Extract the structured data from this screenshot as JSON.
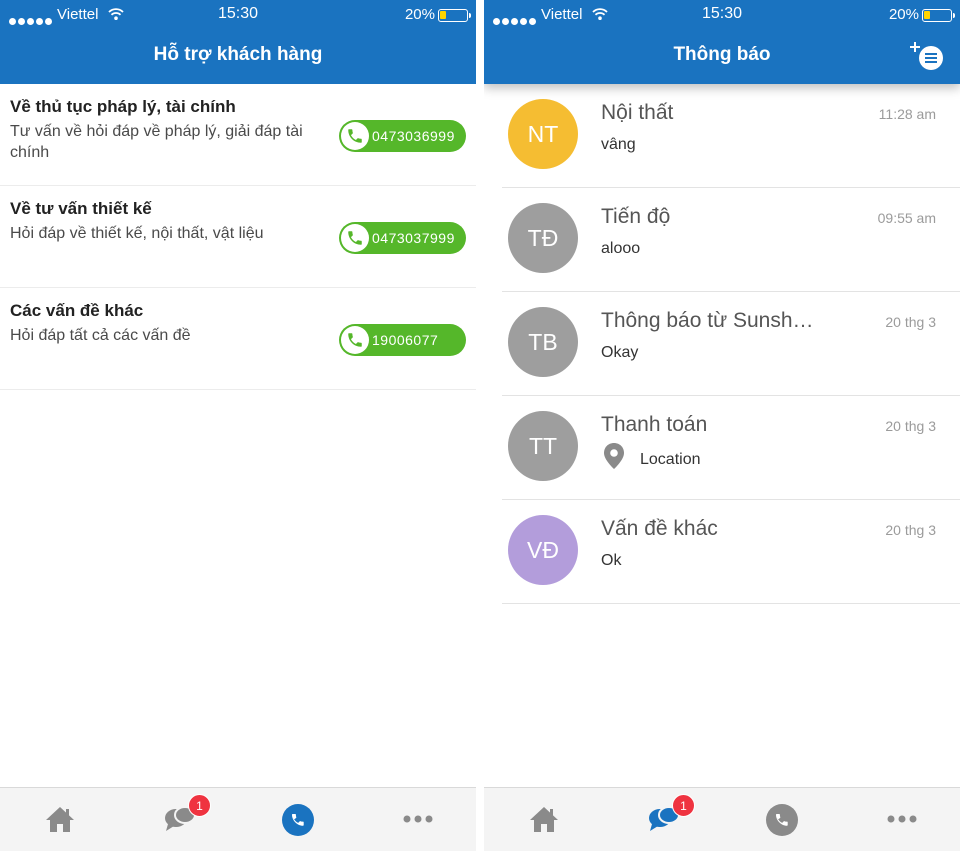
{
  "status_bar": {
    "carrier": "Viettel",
    "time": "15:30",
    "battery": "20%"
  },
  "support": {
    "title": "Hỗ trợ khách hàng",
    "items": [
      {
        "title": "Về thủ tục pháp lý, tài chính",
        "desc": "Tư vấn về hỏi đáp về pháp lý, giải đáp tài chính",
        "phone": "0473036999"
      },
      {
        "title": "Về tư vấn thiết kế",
        "desc": "Hỏi đáp về thiết kế, nội thất, vật liệu",
        "phone": "0473037999"
      },
      {
        "title": "Các vấn đề khác",
        "desc": "Hỏi đáp tất cả các vấn đề",
        "phone": "19006077"
      }
    ]
  },
  "notifications": {
    "title": "Thông báo",
    "items": [
      {
        "initials": "NT",
        "avatar_color": "#f5bd32",
        "name": "Nội thất",
        "time": "11:28 am",
        "message": "vâng"
      },
      {
        "initials": "TĐ",
        "avatar_color": "#9e9e9e",
        "name": "Tiến độ",
        "time": "09:55 am",
        "message": "alooo"
      },
      {
        "initials": "TB",
        "avatar_color": "#9e9e9e",
        "name": "Thông báo từ Sunsh…",
        "time": "20 thg 3",
        "message": "Okay"
      },
      {
        "initials": "TT",
        "avatar_color": "#9e9e9e",
        "name": "Thanh toán",
        "time": "20 thg 3",
        "message": "Location",
        "icon": "location-pin-icon"
      },
      {
        "initials": "VĐ",
        "avatar_color": "#b39ddb",
        "name": "Vấn đề khác",
        "time": "20 thg 3",
        "message": "Ok"
      }
    ]
  },
  "tabbar": {
    "chat_badge": "1",
    "icons": [
      "home-icon",
      "chat-icon",
      "phone-icon",
      "more-icon"
    ]
  },
  "colors": {
    "header": "#1a73c0",
    "call_button": "#55b72a",
    "badge": "#ef3340",
    "active_tab": "#1a73c0",
    "inactive_tab": "#8a8a8a"
  }
}
